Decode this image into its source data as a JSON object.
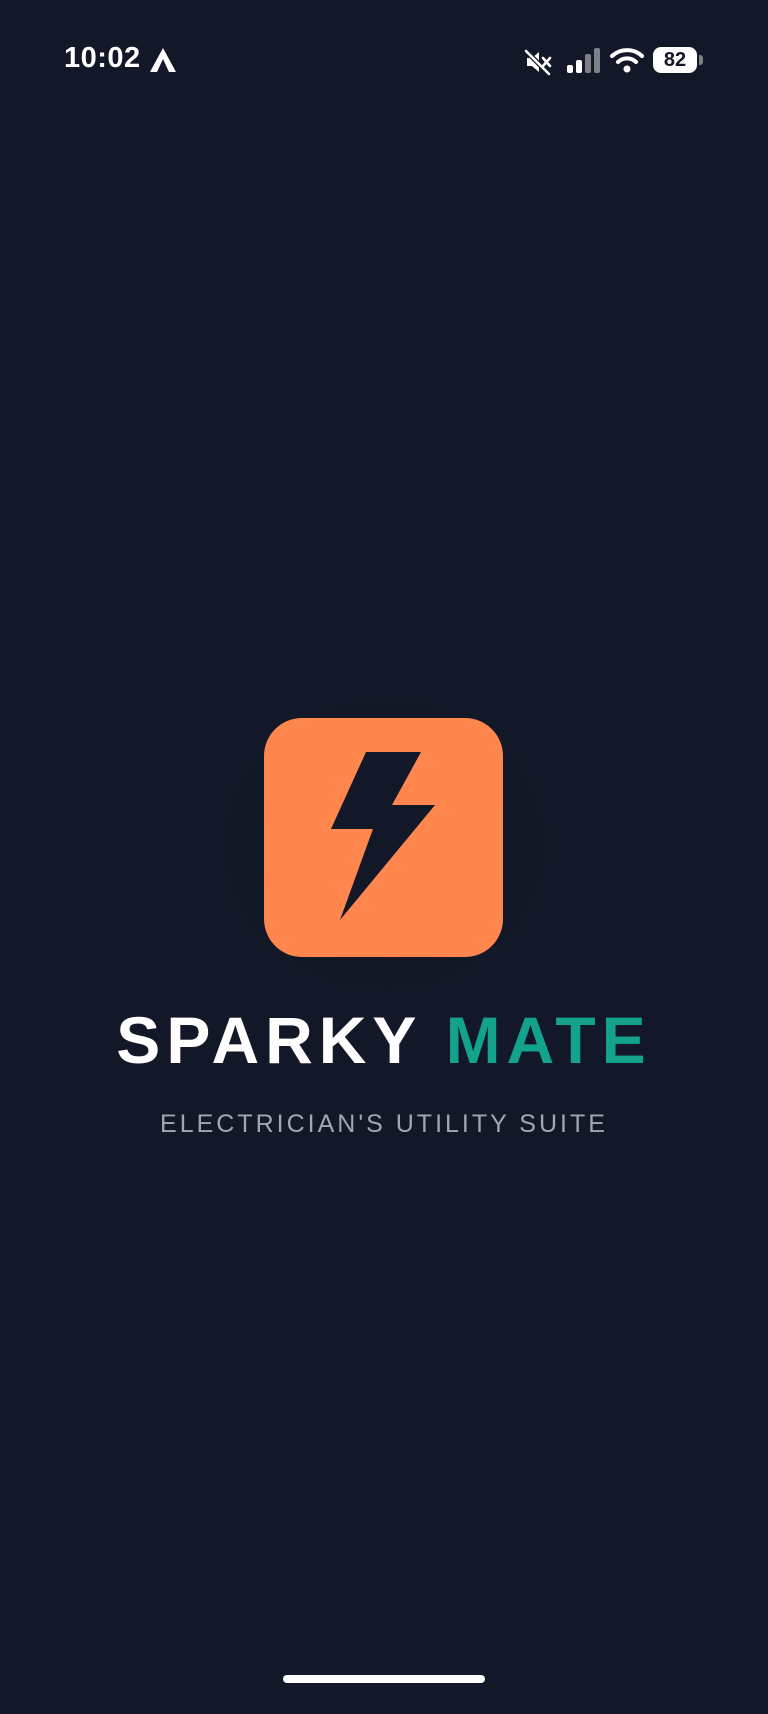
{
  "status_bar": {
    "time": "10:02",
    "battery_level": "82",
    "icons": [
      "navigation-arrow-icon",
      "silent-mode-icon",
      "cellular-signal-icon",
      "wifi-icon",
      "battery-icon"
    ]
  },
  "splash": {
    "logo_icon": "lightning-bolt-icon",
    "title_word_1": "SPARKY",
    "title_word_2": "MATE",
    "tagline": "ELECTRICIAN'S UTILITY SUITE"
  },
  "colors": {
    "background": "#131828",
    "logo_tile": "#ff864d",
    "accent": "#13a38d",
    "title_primary": "#ffffff",
    "tagline": "#a0a6b3"
  }
}
